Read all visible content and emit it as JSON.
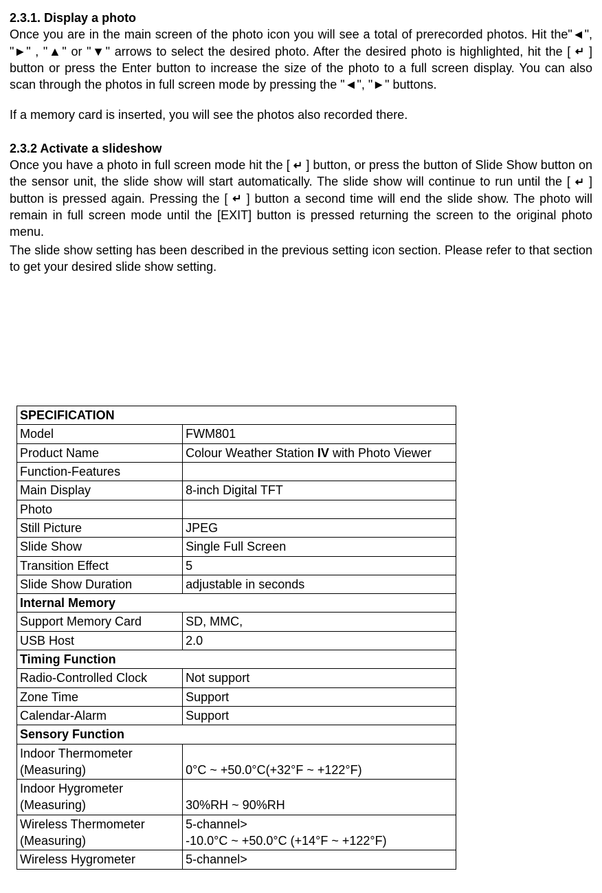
{
  "section1": {
    "title": "2.3.1. Display a photo",
    "p1_a": "Once you are in the main screen of the photo icon you will see a total of prerecorded photos. Hit the\"◄\", \"►\" , \"▲\" or \"▼\" arrows to select the desired photo. After the desired photo is highlighted, hit the [ ",
    "p1_b": " ] button or press the Enter button to increase the size of the photo to a full screen display. You can also scan through the photos in full screen mode by pressing the \"◄\", \"►\" buttons.",
    "p2": "If a memory card is inserted, you will see the photos also recorded there."
  },
  "section2": {
    "title": "2.3.2 Activate a slideshow",
    "p1_a": "Once you have a photo in full screen mode hit the [ ",
    "p1_b": " ] button, or press the button of Slide Show button on the sensor unit, the slide show will start automatically. The slide show will continue to run until the [ ",
    "p1_c": " ] button is pressed again. Pressing the [ ",
    "p1_d": " ] button a second time will end the slide show. The photo will remain in full screen mode until the [EXIT] button is pressed returning the screen to the original photo menu.",
    "p2": "The slide show setting has been described in the previous setting icon section. Please refer to that section to get your desired slide show setting."
  },
  "icons": {
    "enter": "↵"
  },
  "spec_header": "SPECIFICATION",
  "spec_rows": {
    "model_l": "Model",
    "model_v": "FWM801",
    "pname_l": "Product Name",
    "pname_v_a": "Colour Weather Station ",
    "pname_v_b": "IV",
    "pname_v_c": " with Photo Viewer",
    "ff_l": "Function-Features",
    "ff_v": "",
    "md_l": "Main Display",
    "md_v": "8-inch Digital TFT",
    "photo_l": "Photo",
    "photo_v": "",
    "sp_l": "Still Picture",
    "sp_v": "JPEG",
    "ss_l": "Slide Show",
    "ss_v": "Single Full Screen",
    "te_l": "Transition Effect",
    "te_v": "5",
    "ssd_l": "Slide Show Duration",
    "ssd_v": "adjustable in seconds",
    "im_header": "Internal Memory",
    "smc_l": "Support Memory Card",
    "smc_v": "SD, MMC,",
    "usb_l": "USB Host",
    "usb_v": "2.0",
    "tf_header": "Timing Function",
    "rcc_l": "Radio-Controlled Clock",
    "rcc_v": "Not support",
    "zt_l": "Zone Time",
    "zt_v": "Support",
    "ca_l": "Calendar-Alarm",
    "ca_v": "Support",
    "sf_header": "Sensory Function",
    "it_l": "Indoor Thermometer (Measuring)",
    "it_v": "0°C ~ +50.0°C(+32°F ~ +122°F)",
    "ih_l": "Indoor Hygrometer (Measuring)",
    "ih_v": "30%RH ~ 90%RH",
    "wt_l": "Wireless Thermometer (Measuring)",
    "wt_v": "5-channel>\n-10.0°C ~ +50.0°C (+14°F ~ +122°F)",
    "wh_l": "Wireless Hygrometer",
    "wh_v": "5-channel>"
  }
}
